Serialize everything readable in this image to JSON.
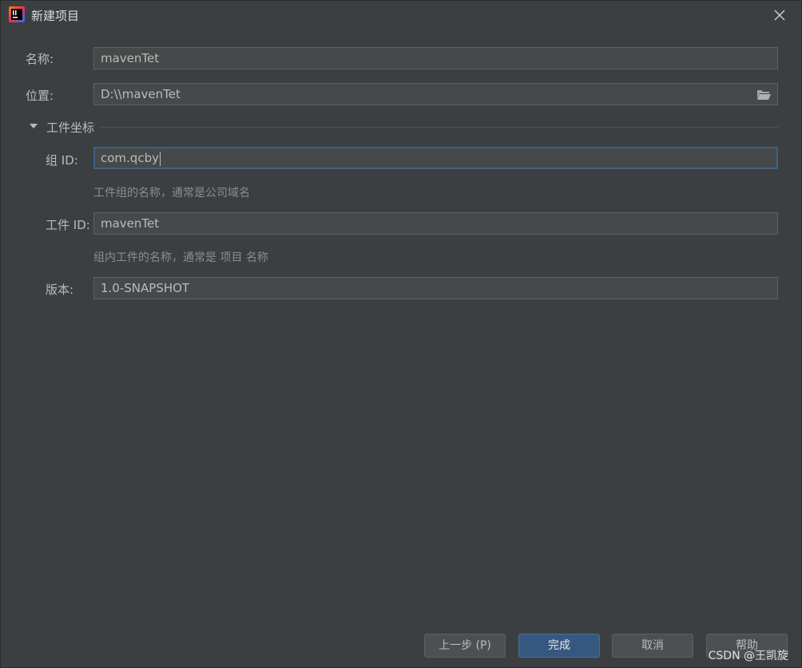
{
  "window": {
    "title": "新建项目"
  },
  "form": {
    "name_label": "名称:",
    "name_value": "mavenTet",
    "location_label": "位置:",
    "location_value": "D:\\\\mavenTet",
    "section_title": "工件坐标",
    "group_label": "组 ID:",
    "group_value": "com.qcby",
    "group_hint": "工件组的名称，通常是公司域名",
    "artifact_label": "工件 ID:",
    "artifact_value": "mavenTet",
    "artifact_hint": "组内工件的名称，通常是 项目 名称",
    "version_label": "版本:",
    "version_value": "1.0-SNAPSHOT"
  },
  "buttons": {
    "previous": "上一步 (P)",
    "finish": "完成",
    "cancel": "取消",
    "help": "帮助"
  },
  "watermark": "CSDN @王凯旋",
  "icons": {
    "app": "intellij-idea-icon",
    "close": "close-icon",
    "folder": "folder-open-icon",
    "toggle": "triangle-down-icon"
  },
  "colors": {
    "background": "#3c3f41",
    "field_background": "#45494a",
    "focus_border": "#3d6185",
    "primary_button": "#365880"
  }
}
